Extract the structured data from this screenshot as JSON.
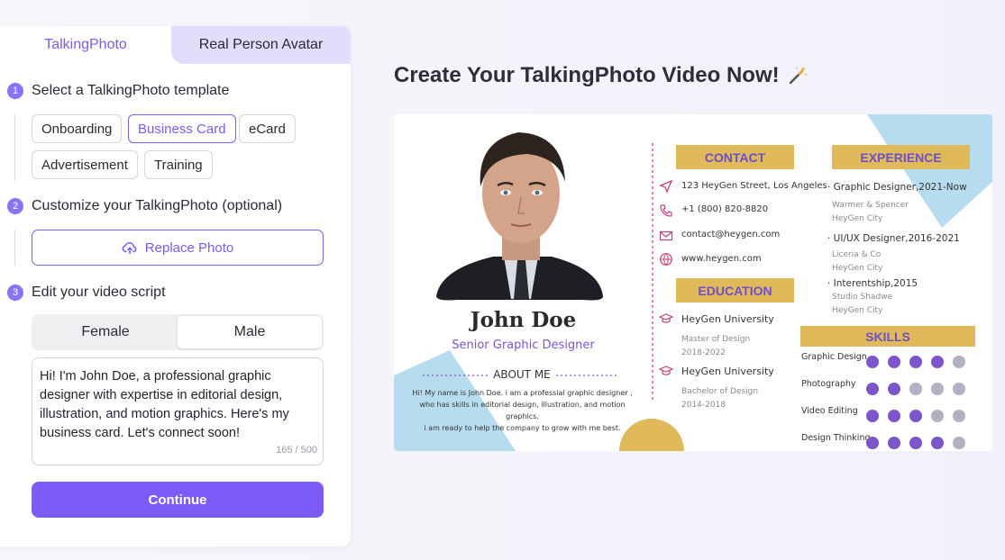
{
  "tabs": {
    "talkingphoto": "TalkingPhoto",
    "real_person": "Real Person Avatar"
  },
  "steps": [
    {
      "num": "1",
      "title": "Select a TalkingPhoto template"
    },
    {
      "num": "2",
      "title": "Customize your TalkingPhoto (optional)"
    },
    {
      "num": "3",
      "title": "Edit your video script"
    }
  ],
  "templates": [
    "Onboarding",
    "Business Card",
    "eCard",
    "Advertisement",
    "Training"
  ],
  "selected_template": "Business Card",
  "replace_photo": "Replace Photo",
  "gender": {
    "female": "Female",
    "male": "Male",
    "selected": "Male"
  },
  "script": {
    "text": "Hi! I'm John Doe, a professional graphic designer with expertise in editorial design, illustration, and motion graphics. Here's my business card. Let's connect soon!",
    "counter": "165 / 500"
  },
  "continue_label": "Continue",
  "headline": "Create Your TalkingPhoto Video Now!",
  "card": {
    "name": "John Doe",
    "role": "Senior Graphic Designer",
    "about_title": "ABOUT ME",
    "about_text": [
      "Hi! My name is John Doe. i am a professial graphic designer ,",
      "who has skills in editorial design, illustration, and motion graphics.",
      "i am ready to help the company to grow with me best."
    ],
    "contact_title": "CONTACT",
    "contact": [
      {
        "icon": "send-icon",
        "text": "123 HeyGen Street, Los Angeles"
      },
      {
        "icon": "phone-icon",
        "text": "+1 (800) 820-8820"
      },
      {
        "icon": "mail-icon",
        "text": "contact@heygen.com"
      },
      {
        "icon": "globe-icon",
        "text": "www.heygen.com"
      }
    ],
    "education_title": "EDUCATION",
    "education": [
      {
        "school": "HeyGen University",
        "degree": "Master of Design",
        "years": "2018-2022"
      },
      {
        "school": "HeyGen University",
        "degree": "Bachelor of Design",
        "years": "2014-2018"
      }
    ],
    "experience_title": "EXPERIENCE",
    "experience": [
      {
        "role": "· Graphic Designer,2021-Now",
        "company": "Warmer & Spencer",
        "place": "HeyGen City"
      },
      {
        "role": "· UI/UX Designer,2016-2021",
        "company": "Liceria & Co",
        "place": "HeyGen City"
      },
      {
        "role": "· Interentship,2015",
        "company": "Studio Shadwe",
        "place": "HeyGen City"
      }
    ],
    "skills_title": "SKILLS",
    "skills": [
      {
        "name": "Graphic Design",
        "level": 4,
        "max": 5
      },
      {
        "name": "Photography",
        "level": 2,
        "max": 5
      },
      {
        "name": "Video Editing",
        "level": 3,
        "max": 5
      },
      {
        "name": "Design Thinking",
        "level": 4,
        "max": 5
      }
    ],
    "colors": {
      "gold": "#e0b95a",
      "purple": "#7b55c9",
      "blue": "#b8dcef",
      "grey": "#b3b0c0"
    }
  }
}
